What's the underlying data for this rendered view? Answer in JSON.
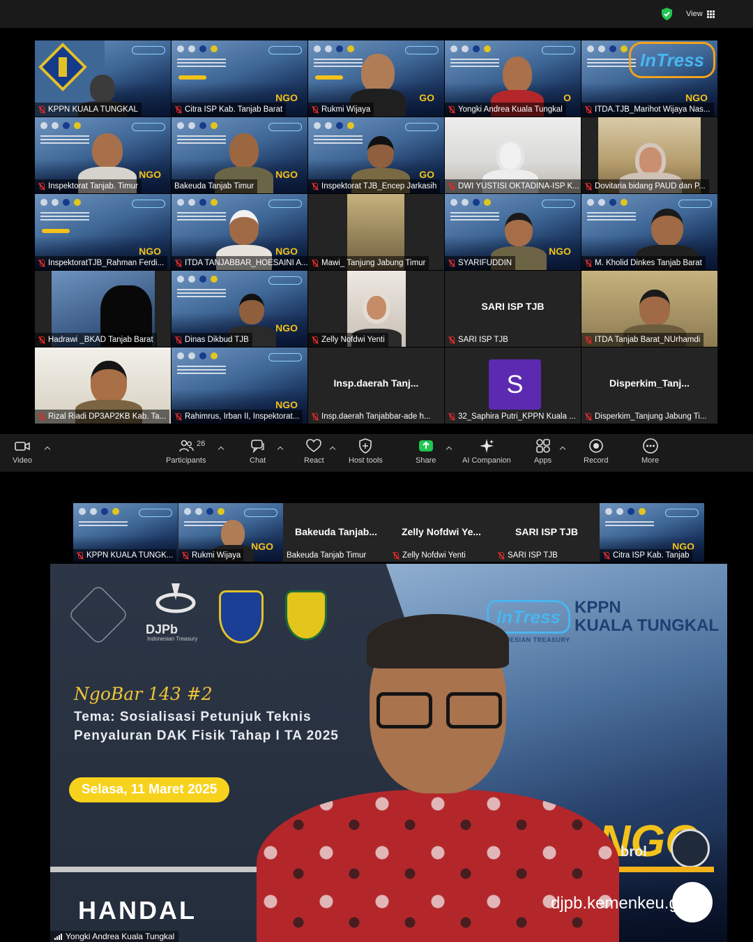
{
  "header": {
    "view_label": "View",
    "security_color": "#23c552",
    "security_icon": "shield-check-icon",
    "view_icon": "grid-icon"
  },
  "gallery": {
    "tiles": [
      {
        "name": "KPPN KUALA TUNGKAL",
        "active": true,
        "muted": true
      },
      {
        "name": "Citra ISP Kab. Tanjab Barat",
        "muted": true
      },
      {
        "name": "Rukmi Wijaya",
        "muted": true
      },
      {
        "name": "Yongki Andrea Kuala Tungkal",
        "muted": true
      },
      {
        "name": "ITDA.TJB_Marihot Wijaya Nas...",
        "muted": true
      },
      {
        "name": "Inspektorat Tanjab. Timur",
        "muted": true
      },
      {
        "name": "Bakeuda Tanjab Timur",
        "muted": false
      },
      {
        "name": "Inspektorat TJB_Encep Jarkasih",
        "muted": true
      },
      {
        "name": "DWI YUSTISI OKTADINA-ISP K...",
        "muted": true
      },
      {
        "name": "Dovitaria bidang PAUD dan P...",
        "muted": true
      },
      {
        "name": "InspektoratTJB_Rahman Ferdi...",
        "muted": true
      },
      {
        "name": "ITDA TANJABBAR_HOESAINI A...",
        "muted": true
      },
      {
        "name": "Mawi_ Tanjung Jabung Timur",
        "muted": true
      },
      {
        "name": "SYARIFUDDIN",
        "muted": true
      },
      {
        "name": "M. Kholid Dinkes Tanjab Barat",
        "muted": true
      },
      {
        "name": "Hadrawi _BKAD Tanjab Barat",
        "muted": true
      },
      {
        "name": "Dinas Dikbud TJB",
        "muted": true
      },
      {
        "name": "Zelly Nofdwi Yenti",
        "muted": true
      },
      {
        "name": "SARI ISP TJB",
        "center": "SARI ISP TJB",
        "muted": true
      },
      {
        "name": "ITDA Tanjab Barat_NUrhamdi",
        "muted": true
      },
      {
        "name": "Rizal Riadi DP3AP2KB Kab. Ta...",
        "muted": true
      },
      {
        "name": "Rahimrus, Irban II, Inspektorat...",
        "muted": true
      },
      {
        "name": "Insp.daerah Tanjabbar-ade h...",
        "center": "Insp.daerah  Tanj...",
        "muted": true
      },
      {
        "name": "32_Saphira Putri_KPPN Kuala ...",
        "avatar": "S",
        "avatar_color": "#5b2ab0",
        "muted": true
      },
      {
        "name": "Disperkim_Tanjung Jabung Ti...",
        "center": "Disperkim_Tanj...",
        "muted": true
      }
    ]
  },
  "toolbar": {
    "video": "Video",
    "participants": "Participants",
    "participants_count": "26",
    "chat": "Chat",
    "react": "React",
    "host_tools": "Host tools",
    "share": "Share",
    "share_color": "#23c552",
    "ai_companion": "AI Companion",
    "apps": "Apps",
    "record": "Record",
    "more": "More"
  },
  "strip": {
    "tiles": [
      {
        "name": "KPPN KUALA TUNGK...",
        "muted": true
      },
      {
        "name": "Rukmi Wijaya",
        "muted": true
      },
      {
        "name": "Bakeuda Tanjab Timur",
        "center": "Bakeuda  Tanjab...",
        "muted": false
      },
      {
        "name": "Zelly Nofdwi Yenti",
        "center": "Zelly  Nofdwi  Ye...",
        "muted": true
      },
      {
        "name": "SARI ISP TJB",
        "center": "SARI ISP TJB",
        "muted": true
      },
      {
        "name": "Citra ISP Kab. Tanjab",
        "muted": true
      }
    ]
  },
  "slide": {
    "djpb": "DJPb",
    "djpb_sub": "Indonesian Treasury",
    "intress": "InTress",
    "indonesian_treasury": "INDONESIAN TREASURY",
    "kppn_line1": "KPPN",
    "kppn_line2": "KUALA TUNGKAL",
    "ngobar": "NgoBar 143 #2",
    "tema": "Tema: Sosialisasi Petunjuk Teknis Penyaluran DAK Fisik Tahap I TA 2025",
    "date": "Selasa, 11 Maret 2025",
    "ngo": "NGO",
    "brol": "brol",
    "handal": "HANDAL",
    "url": "djpb.kemenkeu.go.id",
    "progress": [
      {
        "color": "#c8c8c8",
        "fraction": 0.5
      },
      {
        "color": "#1aa3d9",
        "fraction": 0.3
      },
      {
        "color": "#f3b21a",
        "fraction": 0.2
      }
    ]
  },
  "main": {
    "speaker_name": "Yongki Andrea Kuala Tungkal"
  }
}
